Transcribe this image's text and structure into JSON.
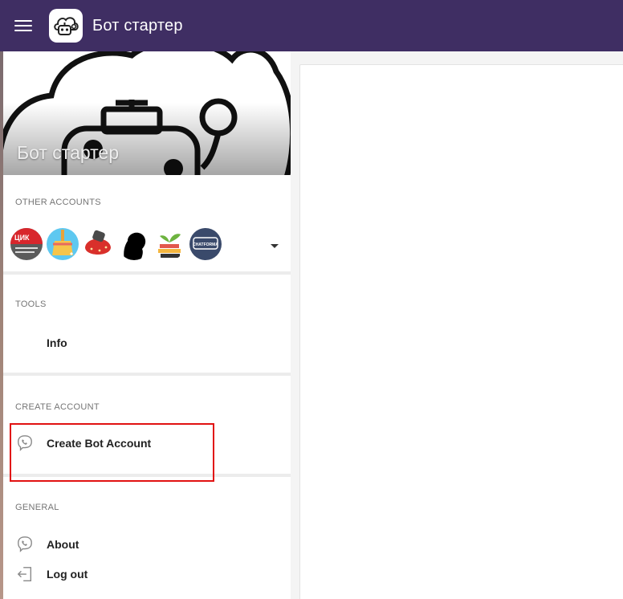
{
  "app": {
    "title": "Бот стартер",
    "logo_icon": "robot-logo-icon",
    "menu_icon": "hamburger-menu-icon",
    "bar_color": "#3f2e63"
  },
  "profile": {
    "name": "Бот стартер",
    "cover_icon": "robot-cloud-cover"
  },
  "other_accounts": {
    "header": "OTHER ACCOUNTS",
    "avatars": [
      {
        "icon": "cik-avatar",
        "text": "ЦИК"
      },
      {
        "icon": "broom-avatar"
      },
      {
        "icon": "strawberry-robot-avatar"
      },
      {
        "icon": "silhouette-avatar"
      },
      {
        "icon": "books-plant-avatar"
      },
      {
        "icon": "chatforma-avatar",
        "text": "CHATFORMA"
      }
    ],
    "more_icon": "caret-down-icon"
  },
  "tools": {
    "header": "TOOLS",
    "items": [
      {
        "label": "Info"
      }
    ]
  },
  "create_account": {
    "header": "CREATE ACCOUNT",
    "items": [
      {
        "label": "Create Bot Account",
        "icon": "viber-icon"
      }
    ]
  },
  "general": {
    "header": "GENERAL",
    "items": [
      {
        "label": "About",
        "icon": "viber-icon"
      },
      {
        "label": "Log out",
        "icon": "logout-icon"
      }
    ]
  },
  "colors": {
    "highlight": "#e11111",
    "text": "#222222",
    "section_header": "#757575"
  }
}
